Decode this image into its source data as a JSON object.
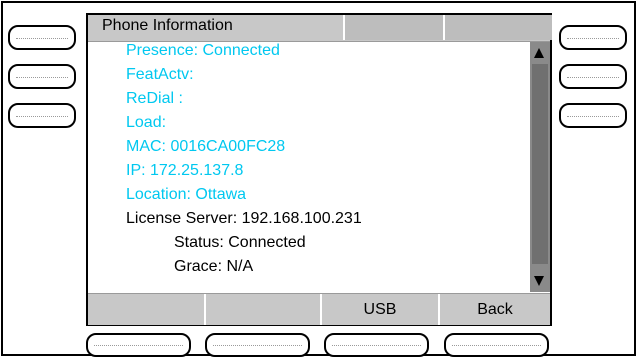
{
  "screen": {
    "title": "Phone Information"
  },
  "info_lines": [
    {
      "text": "Presence:  Connected",
      "color": "#00c8f0"
    },
    {
      "text": "FeatActv:",
      "color": "#00c8f0"
    },
    {
      "text": "ReDial  :",
      "color": "#00c8f0"
    },
    {
      "text": "Load:",
      "color": "#00c8f0"
    },
    {
      "text": "MAC:  0016CA00FC28",
      "color": "#00c8f0"
    },
    {
      "text": "IP:  172.25.137.8",
      "color": "#00c8f0"
    },
    {
      "text": "Location:  Ottawa",
      "color": "#00c8f0"
    },
    {
      "text": "License Server: 192.168.100.231",
      "color": "#000000"
    },
    {
      "text": "Status: Connected",
      "color": "#000000"
    },
    {
      "text": "Grace: N/A",
      "color": "#000000"
    }
  ],
  "softkeys": {
    "slot1": "",
    "slot2": "",
    "usb": "USB",
    "back": "Back"
  },
  "icons": {
    "scroll_up": "triangle-up-icon",
    "scroll_down": "triangle-down-icon"
  }
}
